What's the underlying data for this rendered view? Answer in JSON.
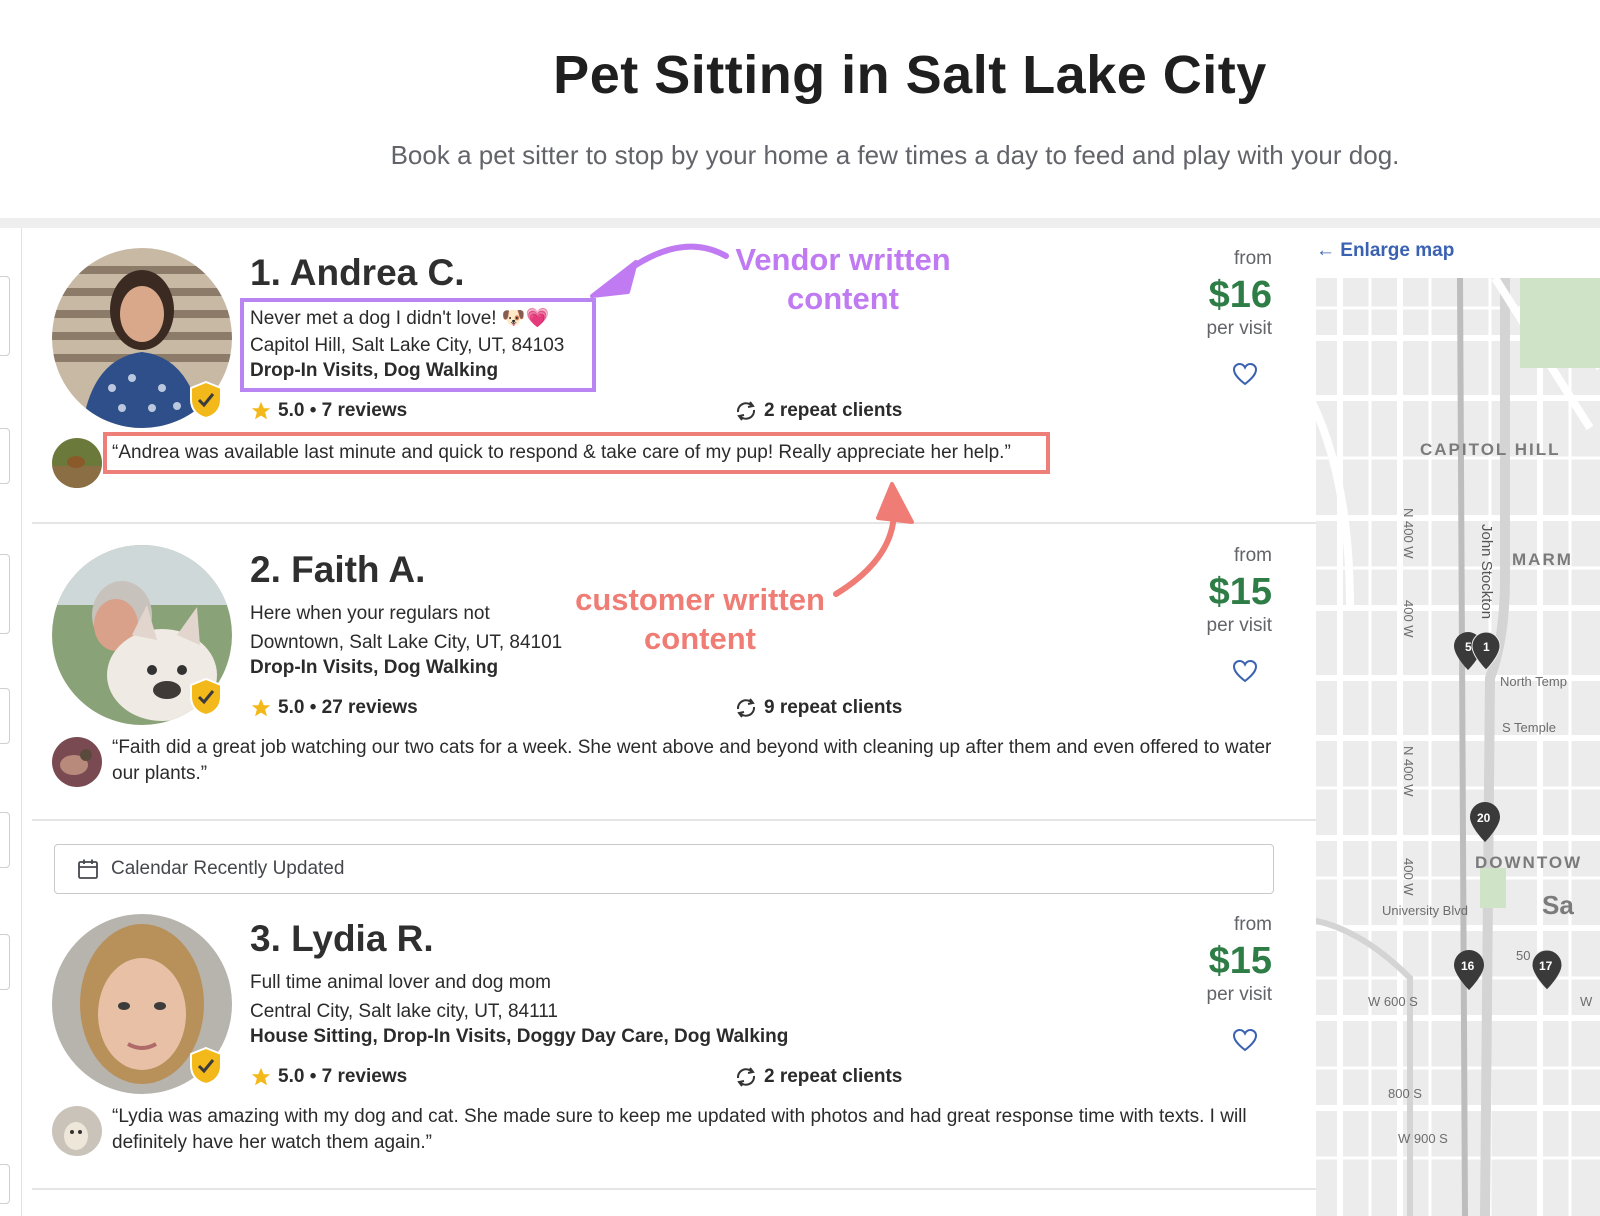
{
  "page": {
    "title": "Pet Sitting in Salt Lake City",
    "subtitle": "Book a pet sitter to stop by your home a few times a day to feed and play with your dog."
  },
  "annotations": {
    "vendor": "Vendor written content",
    "customer": "customer written content"
  },
  "listings": [
    {
      "name": "1. Andrea C.",
      "tagline": "Never met a dog I didn't love! 🐶💗",
      "location": "Capitol Hill, Salt Lake City, UT, 84103",
      "services": "Drop-In Visits, Dog Walking",
      "rating": "5.0 • 7 reviews",
      "repeat_clients": "2 repeat clients",
      "from": "from",
      "price": "$16",
      "per": "per visit",
      "review": "“Andrea was available last minute and quick to respond & take care of my pup! Really appreciate her help.”"
    },
    {
      "name": "2. Faith A.",
      "tagline": "Here when your regulars not",
      "location": "Downtown, Salt Lake City, UT, 84101",
      "services": "Drop-In Visits, Dog Walking",
      "rating": "5.0 • 27 reviews",
      "repeat_clients": "9 repeat clients",
      "from": "from",
      "price": "$15",
      "per": "per visit",
      "review": "“Faith did a great job watching our two cats for a week. She went above and beyond with cleaning up after them and even offered to water our plants.”"
    },
    {
      "name": "3. Lydia R.",
      "tagline": "Full time animal lover and dog mom",
      "location": "Central City, Salt lake city, UT, 84111",
      "services": "House Sitting, Drop-In Visits, Doggy Day Care, Dog Walking",
      "rating": "5.0 • 7 reviews",
      "repeat_clients": "2 repeat clients",
      "from": "from",
      "price": "$15",
      "per": "per visit",
      "review": "“Lydia was amazing with my dog and cat. She made sure to keep me updated with photos and had great response time with texts. I will definitely have her watch them again.”"
    }
  ],
  "calendar_banner": "Calendar Recently Updated",
  "map": {
    "enlarge": "← Enlarge map",
    "labels": {
      "capitol_hill": "CAPITOL HILL",
      "marm": "MARM",
      "downtown": "DOWNTOW",
      "sa": "Sa",
      "n400w_1": "N 400 W",
      "n400w_2": "N 400 W",
      "w400_1": "400 W",
      "w400_2": "400 W",
      "john_stockton": "John Stockton",
      "north_temple": "North Temp",
      "s_temple": "S Temple",
      "university": "University Blvd",
      "w600s": "W 600 S",
      "s800": "800 S",
      "w900s": "W 900 S",
      "fifty": "50",
      "w": "W"
    },
    "pins": [
      "5",
      "1",
      "20",
      "16",
      "17"
    ]
  },
  "colors": {
    "price_green": "#2e7d47",
    "vendor_purple": "#b985f3",
    "customer_coral": "#ee7f78",
    "link_blue": "#3a62b0",
    "star_gold": "#f3b91a"
  },
  "icons": [
    "star-icon",
    "repeat-icon",
    "heart-icon",
    "verified-badge-icon",
    "calendar-icon",
    "map-pin-icon"
  ]
}
